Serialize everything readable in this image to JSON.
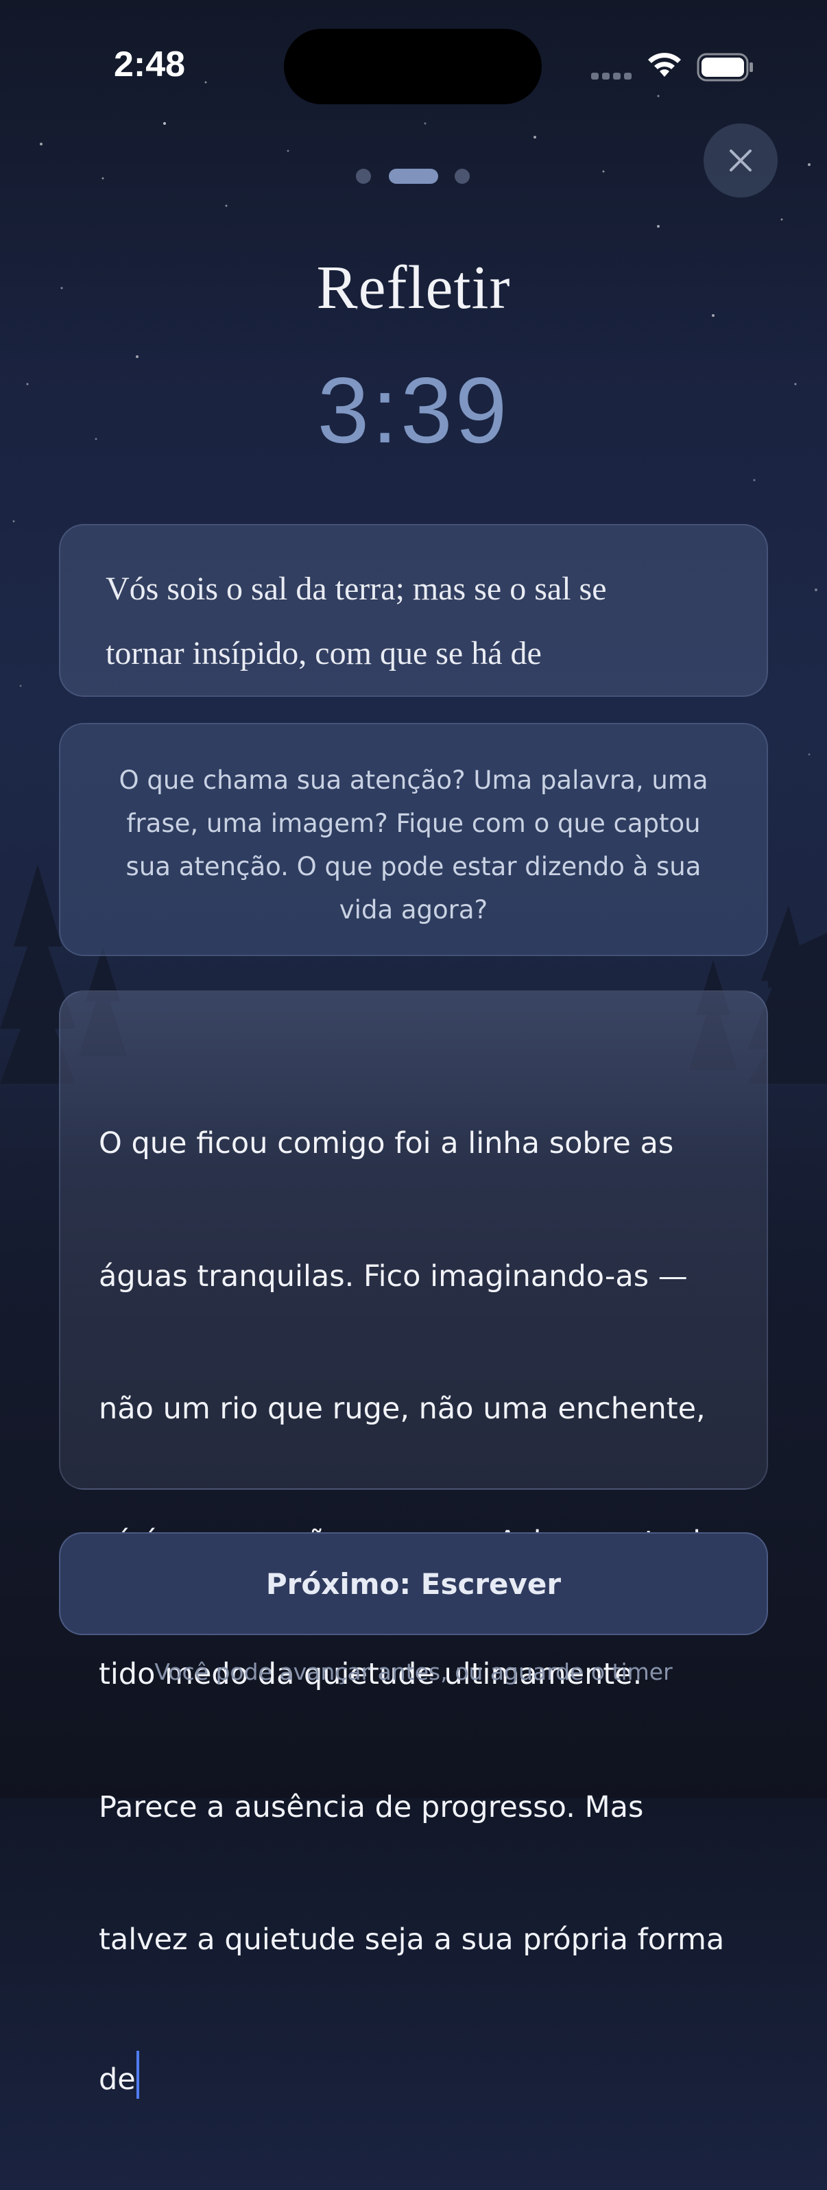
{
  "status_bar": {
    "time": "2:48"
  },
  "progress": {
    "total_steps": 3,
    "current_step": 2
  },
  "header": {
    "title": "Refletir",
    "timer": "3:39"
  },
  "verse": {
    "line1": "Vós sois o sal da terra; mas se o sal se",
    "line2": "tornar insípido, com que se há de"
  },
  "prompt": {
    "line1": "O que chama sua atenção? Uma palavra, uma",
    "line2": "frase, uma imagem? Fique com o que captou",
    "line3": "sua atenção. O que pode estar dizendo à sua",
    "line4": "vida agora?"
  },
  "entry": {
    "lines": [
      "O que ficou comigo foi a linha sobre as",
      "águas tranquilas. Fico imaginando-as —",
      "não um rio que ruge, não uma enchente,",
      "só água que não se move. Acho que tenho",
      "tido medo da quietude ultimamente.",
      "Parece a ausência de progresso. Mas",
      "talvez a quietude seja a sua própria forma",
      "de"
    ]
  },
  "actions": {
    "next_label": "Próximo: Escrever",
    "hint": "Você pode avançar antes, ou aguarde o timer"
  },
  "icons": {
    "close": "close-icon",
    "wifi": "wifi-icon",
    "battery": "battery-icon",
    "signal": "signal-icon"
  },
  "colors": {
    "accent": "#7f97c2",
    "caret": "#4f7cf2",
    "button": "#2f3b5e"
  }
}
